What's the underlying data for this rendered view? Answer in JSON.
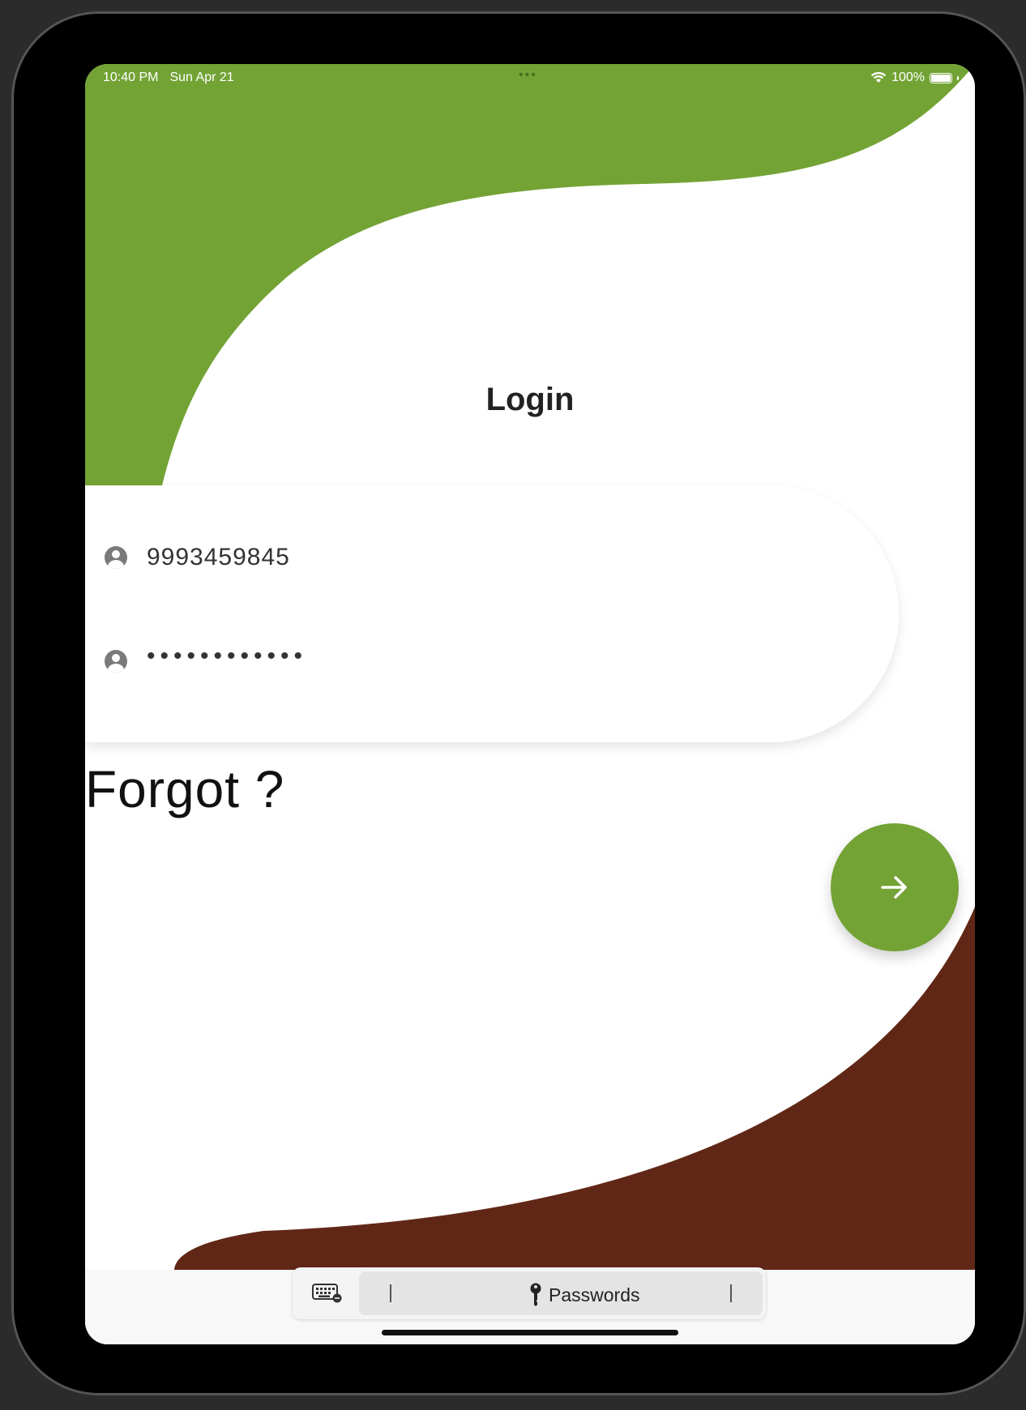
{
  "status_bar": {
    "time": "10:40 PM",
    "date": "Sun Apr 21",
    "dots": "•••",
    "battery_percent": "100%"
  },
  "login": {
    "title": "Login",
    "username_value": "9993459845",
    "password_masked": "••••••••••••",
    "forgot_label": "Forgot ?",
    "submit_icon": "arrow-right-icon"
  },
  "keyboard_bar": {
    "keyboard_icon": "keyboard-icon",
    "passwords_label": "Passwords",
    "key_icon": "key-icon"
  },
  "colors": {
    "accent_green": "#73a335",
    "brown": "#612716",
    "text_dark": "#222222"
  }
}
